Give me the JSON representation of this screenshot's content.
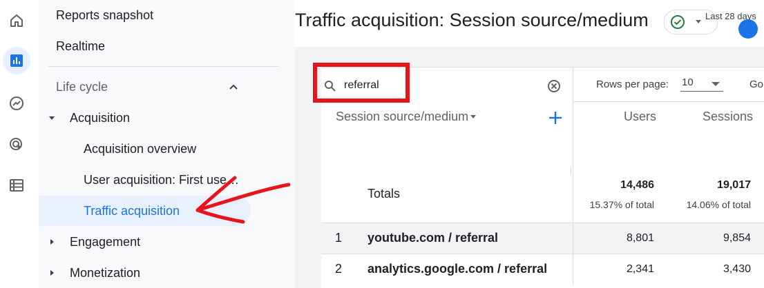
{
  "nav": {
    "reports_snapshot": "Reports snapshot",
    "realtime": "Realtime",
    "lifecycle": "Life cycle",
    "acquisition": "Acquisition",
    "acquisition_overview": "Acquisition overview",
    "user_acquisition": "User acquisition: First use…",
    "traffic_acquisition": "Traffic acquisition",
    "engagement": "Engagement",
    "monetization": "Monetization"
  },
  "header": {
    "title": "Traffic acquisition: Session source/medium",
    "date_range": "Last 28 days"
  },
  "table": {
    "search_value": "referral",
    "rows_per_page_label": "Rows per page:",
    "rows_per_page_value": "10",
    "goto_label": "Go",
    "dimension_header": "Session source/medium",
    "columns": [
      "Users",
      "Sessions"
    ],
    "totals_label": "Totals",
    "totals": [
      {
        "value": "14,486",
        "pct": "15.37% of total"
      },
      {
        "value": "19,017",
        "pct": "14.06% of total"
      }
    ],
    "rows": [
      {
        "index": "1",
        "source": "youtube.com / referral",
        "users": "8,801",
        "sessions": "9,854"
      },
      {
        "index": "2",
        "source": "analytics.google.com / referral",
        "users": "2,341",
        "sessions": "3,430"
      }
    ]
  },
  "colors": {
    "accent": "#1a73e8",
    "annotation_red": "#e8141c",
    "selected_bg": "#e8f0fe",
    "status_green": "#188038"
  }
}
